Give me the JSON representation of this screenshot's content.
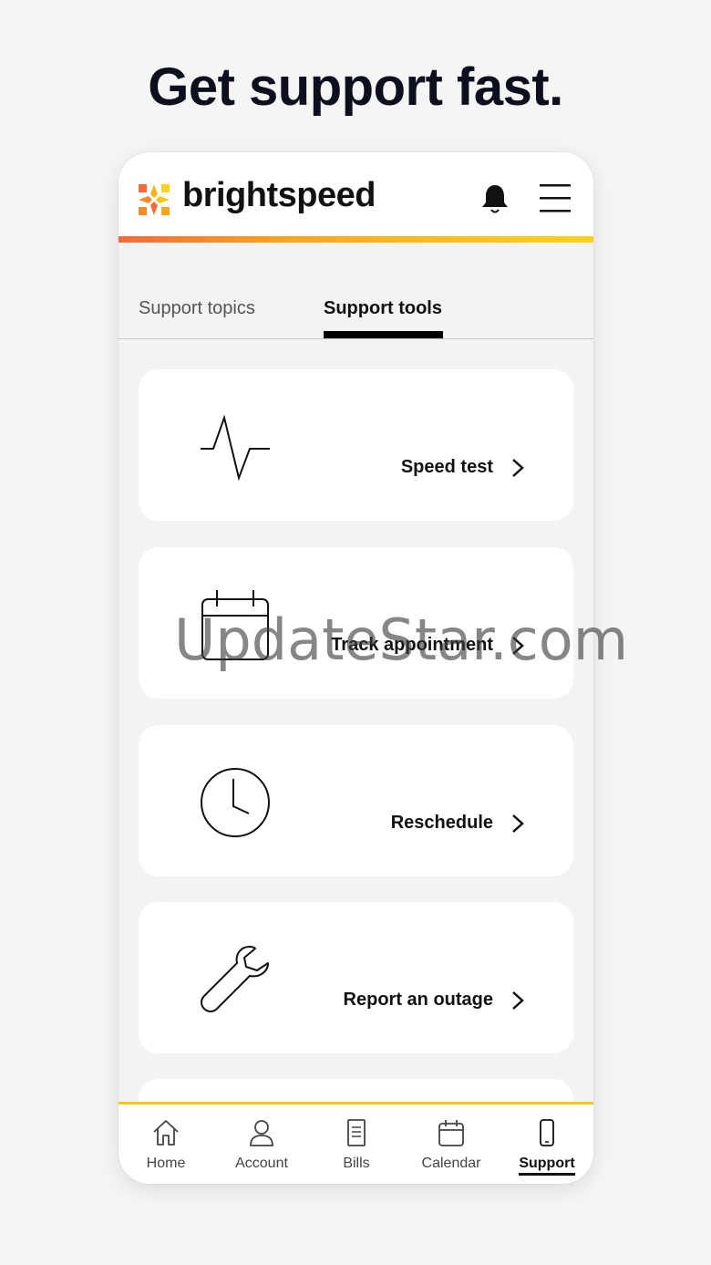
{
  "headline": "Get support fast.",
  "app": {
    "logo_text": "brightspeed",
    "accent_colors": [
      "#f36b3b",
      "#fba51c",
      "#fcd21a"
    ]
  },
  "tabs": [
    {
      "label": "Support topics",
      "active": false
    },
    {
      "label": "Support tools",
      "active": true
    }
  ],
  "tools": [
    {
      "label": "Speed test",
      "icon": "pulse-icon"
    },
    {
      "label": "Track appointment",
      "icon": "calendar-icon"
    },
    {
      "label": "Reschedule",
      "icon": "clock-icon"
    },
    {
      "label": "Report an outage",
      "icon": "wrench-icon"
    }
  ],
  "watermark": "UpdateStar.com",
  "bottom_nav": [
    {
      "label": "Home",
      "icon": "home-icon",
      "active": false
    },
    {
      "label": "Account",
      "icon": "person-icon",
      "active": false
    },
    {
      "label": "Bills",
      "icon": "bill-icon",
      "active": false
    },
    {
      "label": "Calendar",
      "icon": "calendar-icon",
      "active": false
    },
    {
      "label": "Support",
      "icon": "phone-icon",
      "active": true
    }
  ]
}
